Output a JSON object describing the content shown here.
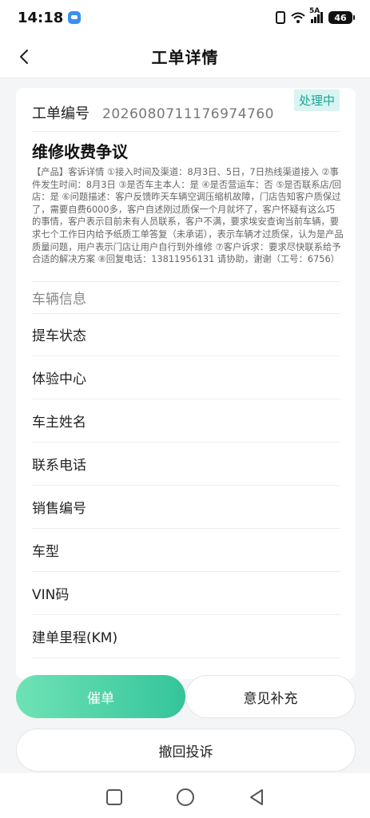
{
  "status_bar": {
    "time": "14:18",
    "signal_label": "5A",
    "battery": "46"
  },
  "header": {
    "title": "工单详情"
  },
  "order": {
    "status_badge": "处理中",
    "number_label": "工单编号",
    "number_value": "2026080711176974760",
    "issue_title": "维修收费争议",
    "issue_description": "【产品】客诉详情 ①接入时间及渠道：8月3日、5日，7日热线渠道接入 ②事件发生时间：8月3日 ③是否车主本人：是 ④是否营运车：否 ⑤是否联系店/回店：是 ⑥问题描述：客户反馈昨天车辆空调压缩机故障，门店告知客户质保过了，需要自费6000多，客户自述刚过质保一个月就坏了，客户怀疑有这么巧的事情，客户表示目前未有人员联系，客户不满，要求埃安查询当前车辆，要求七个工作日内给予纸质工单答复（未承诺），表示车辆才过质保，认为是产品质量问题，用户表示门店让用户自行到外维修 ⑦客户诉求：要求尽快联系给予合适的解决方案 ⑧回复电话：13811956131 请协助，谢谢（工号：6756）"
  },
  "vehicle": {
    "section_title": "车辆信息",
    "fields": [
      {
        "label": "提车状态"
      },
      {
        "label": "体验中心"
      },
      {
        "label": "车主姓名"
      },
      {
        "label": "联系电话"
      },
      {
        "label": "销售编号"
      },
      {
        "label": "车型"
      },
      {
        "label": "VIN码"
      },
      {
        "label": "建单里程(KM)"
      }
    ]
  },
  "actions": {
    "urge": "催单",
    "supplement": "意见补充",
    "withdraw": "撤回投诉"
  },
  "colors": {
    "accent": "#34c49a",
    "badge_bg": "#d9f4f1",
    "badge_text": "#17a89a",
    "page_bg": "#f4f5f7"
  },
  "icons": {
    "back": "chevron-left-icon",
    "nav_recent": "square-icon",
    "nav_home": "circle-icon",
    "nav_back": "triangle-back-icon"
  }
}
